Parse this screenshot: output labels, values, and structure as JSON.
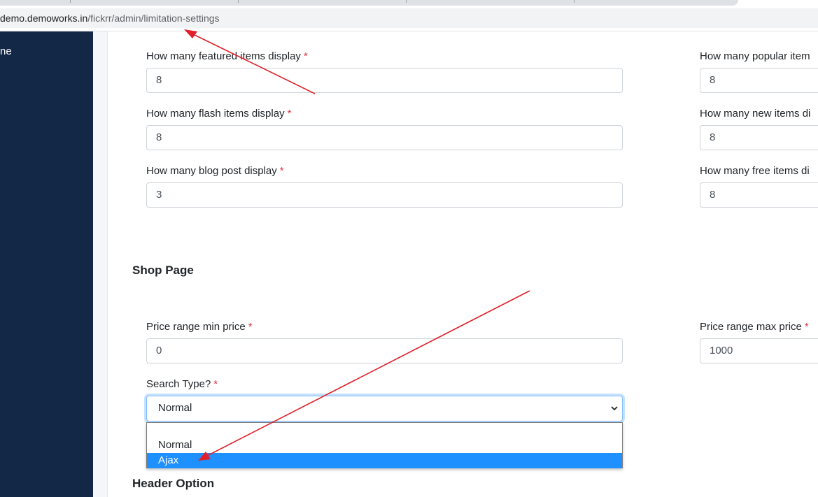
{
  "browser": {
    "url_host": "demo.demoworks.in",
    "url_path": "/fickrr/admin/limitation-settings"
  },
  "sidebar": {
    "items": [
      {
        "label": "ne"
      }
    ]
  },
  "limits": {
    "featured": {
      "label": "How many featured items display",
      "value": "8"
    },
    "flash": {
      "label": "How many flash items display",
      "value": "8"
    },
    "blog": {
      "label": "How many blog post display",
      "value": "3"
    },
    "popular": {
      "label": "How many popular item",
      "value": "8"
    },
    "new_items": {
      "label": "How many new items di",
      "value": "8"
    },
    "free": {
      "label": "How many free items di",
      "value": "8"
    }
  },
  "shop_page": {
    "title": "Shop Page",
    "min_price": {
      "label": "Price range min price",
      "value": "0"
    },
    "max_price": {
      "label": "Price range max price",
      "value": "1000"
    },
    "search_type": {
      "label": "Search Type?",
      "selected": "Normal",
      "options": [
        "Normal",
        "Ajax"
      ],
      "highlighted": "Ajax"
    }
  },
  "header_option": {
    "title": "Header Option"
  },
  "required_mark": "*",
  "colors": {
    "sidebar_bg": "#132847",
    "annotation_arrow": "#e0202a",
    "option_highlight": "#1e90ff",
    "required": "#dc3545"
  }
}
